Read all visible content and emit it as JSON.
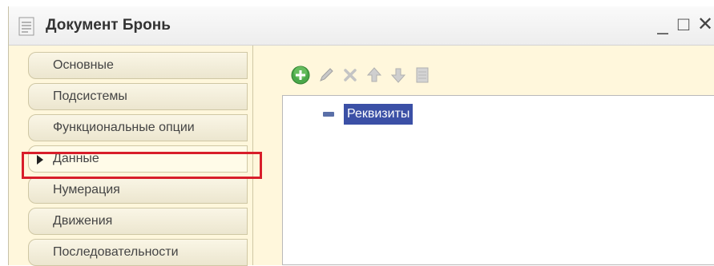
{
  "window": {
    "title": "Документ Бронь",
    "minimize_label": "_",
    "maximize_label": "□",
    "close_label": "✕"
  },
  "tabs": [
    {
      "label": "Основные"
    },
    {
      "label": "Подсистемы"
    },
    {
      "label": "Функциональные опции"
    },
    {
      "label": "Данные",
      "active": true
    },
    {
      "label": "Нумерация"
    },
    {
      "label": "Движения"
    },
    {
      "label": "Последовательности"
    }
  ],
  "toolbar": {
    "icons": [
      "add-icon",
      "edit-icon",
      "delete-icon",
      "move-up-icon",
      "move-down-icon",
      "sort-icon"
    ]
  },
  "tree": {
    "root_label": "Реквизиты"
  },
  "colors": {
    "highlight": "#d81e2a",
    "selection": "#3b50a6",
    "panel_bg": "#fff7dc"
  }
}
